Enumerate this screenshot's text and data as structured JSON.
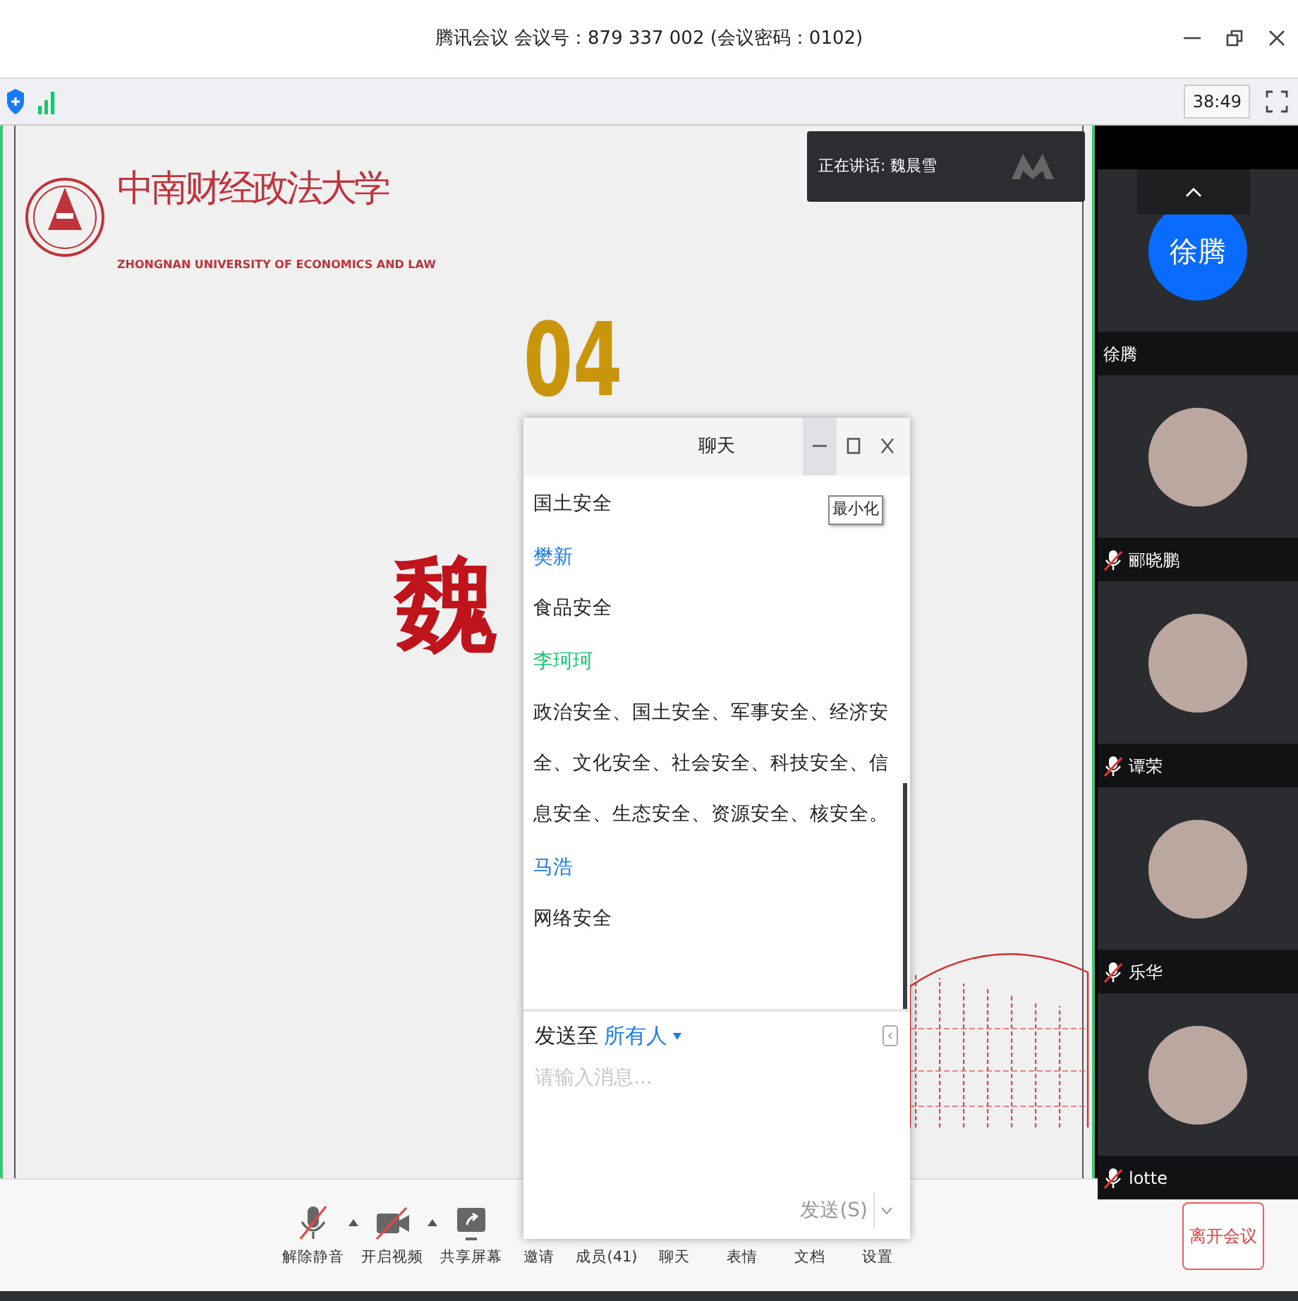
{
  "window": {
    "title": "腾讯会议 会议号：879 337 002  (会议密码：0102)"
  },
  "status_bar": {
    "timer": "38:49"
  },
  "slide": {
    "logo_cn": "中南财经政法大学",
    "logo_en": "ZHONGNAN UNIVERSITY OF ECONOMICS AND LAW",
    "number": "04",
    "heading": "魏"
  },
  "speaker": {
    "label": "正在讲话: 魏晨雪"
  },
  "participants": [
    {
      "name": "徐腾",
      "avatar_text": "徐腾",
      "muted": false
    },
    {
      "name": "郦晓鹏",
      "muted": true
    },
    {
      "name": "谭荣",
      "muted": true
    },
    {
      "name": "乐华",
      "muted": true
    },
    {
      "name": "lotte",
      "muted": true
    }
  ],
  "toolbar": [
    {
      "kind": "mic",
      "label": "解除静音",
      "menu": true
    },
    {
      "kind": "camera",
      "label": "开启视频",
      "menu": true
    },
    {
      "kind": "share",
      "label": "共享屏幕",
      "menu": false
    },
    {
      "kind": "invite",
      "label": "邀请",
      "menu": false
    },
    {
      "kind": "members",
      "label": "成员(41)",
      "menu": false
    },
    {
      "kind": "chat",
      "label": "聊天",
      "menu": false
    },
    {
      "kind": "emoji",
      "label": "表情",
      "menu": false
    },
    {
      "kind": "docs",
      "label": "文档",
      "menu": false
    },
    {
      "kind": "settings",
      "label": "设置",
      "menu": false
    }
  ],
  "leave_button": "离开会议",
  "chat": {
    "title": "聊天",
    "tooltip": "最小化",
    "messages": [
      {
        "kind": "text",
        "text": "国土安全"
      },
      {
        "kind": "sender",
        "text": "樊新",
        "color": "#1a7cf5"
      },
      {
        "kind": "text",
        "text": "食品安全"
      },
      {
        "kind": "sender",
        "text": "李珂珂",
        "color": "#19c46a"
      },
      {
        "kind": "text",
        "text": "政治安全、国土安全、军事安全、经济安全、文化安全、社会安全、科技安全、信息安全、生态安全、资源安全、核安全。"
      },
      {
        "kind": "sender",
        "text": "马浩",
        "color": "#1a7cf5"
      },
      {
        "kind": "text",
        "text": "网络安全"
      }
    ],
    "recipient_label": "发送至",
    "recipient": "所有人",
    "placeholder": "请输入消息...",
    "send": "发送(S)"
  }
}
